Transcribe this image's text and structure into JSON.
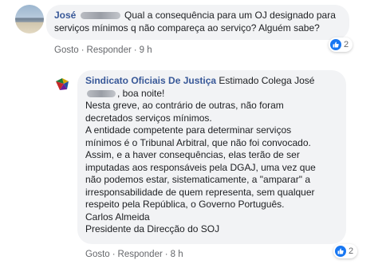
{
  "comment": {
    "author": "José",
    "text": "Qual a consequência para um OJ designado para serviços mínimos q não compareça ao serviço? Alguém sabe?",
    "text_line1": "Qual a consequência para um OJ designado para",
    "text_line2": "serviços mínimos q não compareça ao serviço? Alguém sabe?",
    "reaction_count": "2",
    "actions": {
      "like": "Gosto",
      "reply": "Responder",
      "separator": "·",
      "time": "9 h"
    }
  },
  "reply": {
    "author": "Sindicato Oficiais De Justiça",
    "lines": [
      "Estimado Colega José",
      ", boa noite!",
      "Nesta greve, ao contrário de outras, não foram",
      "decretados serviços mínimos.",
      "A entidade competente para determinar serviços",
      "mínimos é o Tribunal Arbitral, que não foi convocado.",
      "Assim, e a haver consequências, elas terão de ser",
      "imputadas aos responsáveis pela DGAJ, uma vez que",
      "não podemos estar, sistematicamente, a \"amparar\" a",
      "irresponsabilidade de quem representa, sem qualquer",
      "respeito pela República, o Governo Português.",
      "Carlos Almeida",
      "Presidente da Direcção do SOJ"
    ],
    "reaction_count": "2",
    "actions": {
      "like": "Gosto",
      "reply": "Responder",
      "separator": "·",
      "time": "8 h"
    }
  },
  "colors": {
    "author": "#385898",
    "like_blue": "#1877f2",
    "bubble": "#f2f3f5",
    "meta": "#65676b"
  },
  "icons": {
    "reaction": "like-icon"
  }
}
